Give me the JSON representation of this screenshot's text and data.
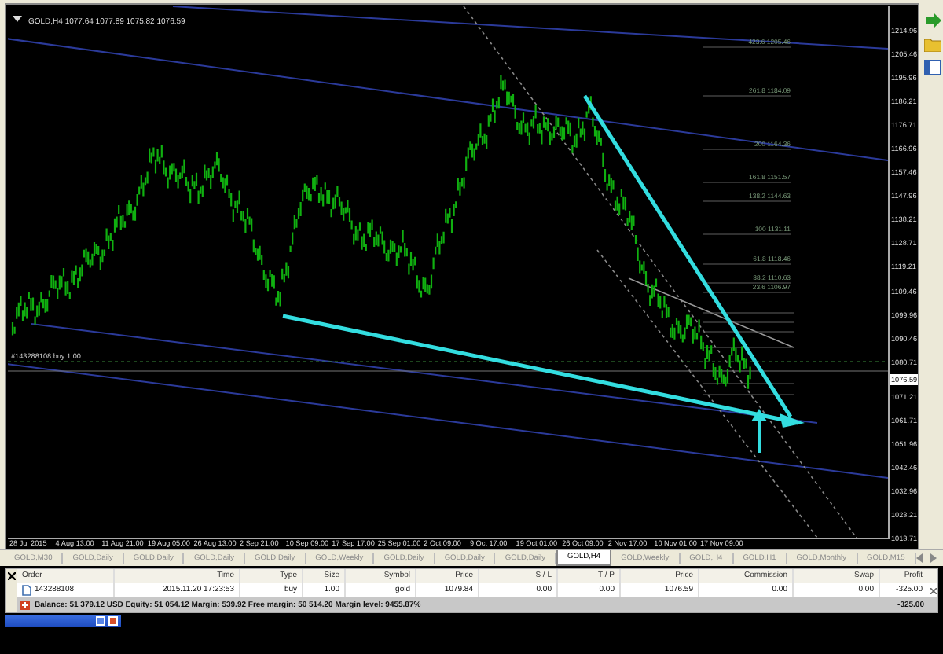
{
  "chart": {
    "title": "GOLD,H4 1077.64 1077.89 1075.82 1076.59",
    "order_label": "#143288108 buy 1.00",
    "fib_levels": [
      "423.6 1205.46",
      "261.8 1184.09",
      "200 1164.36",
      "161.8 1151.57",
      "138.2 1144.63",
      "100 1131.11",
      "61.8 1118.46",
      "38.2 1110.63",
      "23.6 1106.97"
    ],
    "price_axis": [
      {
        "label": "1214.96",
        "current": false
      },
      {
        "label": "1205.46",
        "current": false
      },
      {
        "label": "1195.96",
        "current": false
      },
      {
        "label": "1186.21",
        "current": false
      },
      {
        "label": "1176.71",
        "current": false
      },
      {
        "label": "1166.96",
        "current": false
      },
      {
        "label": "1157.46",
        "current": false
      },
      {
        "label": "1147.96",
        "current": false
      },
      {
        "label": "1138.21",
        "current": false
      },
      {
        "label": "1128.71",
        "current": false
      },
      {
        "label": "1119.21",
        "current": false
      },
      {
        "label": "1109.46",
        "current": false
      },
      {
        "label": "1099.96",
        "current": false
      },
      {
        "label": "1090.46",
        "current": false
      },
      {
        "label": "1080.71",
        "current": false
      },
      {
        "label": "1076.59",
        "current": true
      },
      {
        "label": "1071.21",
        "current": false
      },
      {
        "label": "1061.71",
        "current": false
      },
      {
        "label": "1051.96",
        "current": false
      },
      {
        "label": "1042.46",
        "current": false
      },
      {
        "label": "1032.96",
        "current": false
      },
      {
        "label": "1023.21",
        "current": false
      },
      {
        "label": "1013.71",
        "current": false
      }
    ],
    "time_axis": [
      "28 Jul 2015",
      "4 Aug 13:00",
      "11 Aug 21:00",
      "19 Aug 05:00",
      "26 Aug 13:00",
      "2 Sep 21:00",
      "10 Sep 09:00",
      "17 Sep 17:00",
      "25 Sep 01:00",
      "2 Oct 09:00",
      "9 Oct 17:00",
      "19 Oct 01:00",
      "26 Oct 09:00",
      "2 Nov 17:00",
      "10 Nov 01:00",
      "17 Nov 09:00"
    ]
  },
  "tabs": [
    {
      "label": "GOLD,M30",
      "selected": false
    },
    {
      "label": "GOLD,Daily",
      "selected": false
    },
    {
      "label": "GOLD,Daily",
      "selected": false
    },
    {
      "label": "GOLD,Daily",
      "selected": false
    },
    {
      "label": "GOLD,Daily",
      "selected": false
    },
    {
      "label": "GOLD,Weekly",
      "selected": false
    },
    {
      "label": "GOLD,Daily",
      "selected": false
    },
    {
      "label": "GOLD,Daily",
      "selected": false
    },
    {
      "label": "GOLD,Daily",
      "selected": false
    },
    {
      "label": "GOLD,H4",
      "selected": true
    },
    {
      "label": "GOLD,Weekly",
      "selected": false
    },
    {
      "label": "GOLD,H4",
      "selected": false
    },
    {
      "label": "GOLD,H1",
      "selected": false
    },
    {
      "label": "GOLD,Monthly",
      "selected": false
    },
    {
      "label": "GOLD,M15",
      "selected": false
    }
  ],
  "terminal": {
    "columns": [
      "Order",
      "Time",
      "Type",
      "Size",
      "Symbol",
      "Price",
      "S / L",
      "T / P",
      "Price",
      "Commission",
      "Swap",
      "Profit"
    ],
    "rows": [
      [
        "143288108",
        "2015.11.20 17:23:53",
        "buy",
        "1.00",
        "gold",
        "1079.84",
        "0.00",
        "0.00",
        "1076.59",
        "0.00",
        "0.00",
        "-325.00"
      ]
    ],
    "summary": {
      "text": "Balance: 51 379.12 USD  Equity: 51 054.12  Margin: 539.92  Free margin: 50 514.20  Margin level: 9455.87%",
      "profit": "-325.00"
    }
  }
}
